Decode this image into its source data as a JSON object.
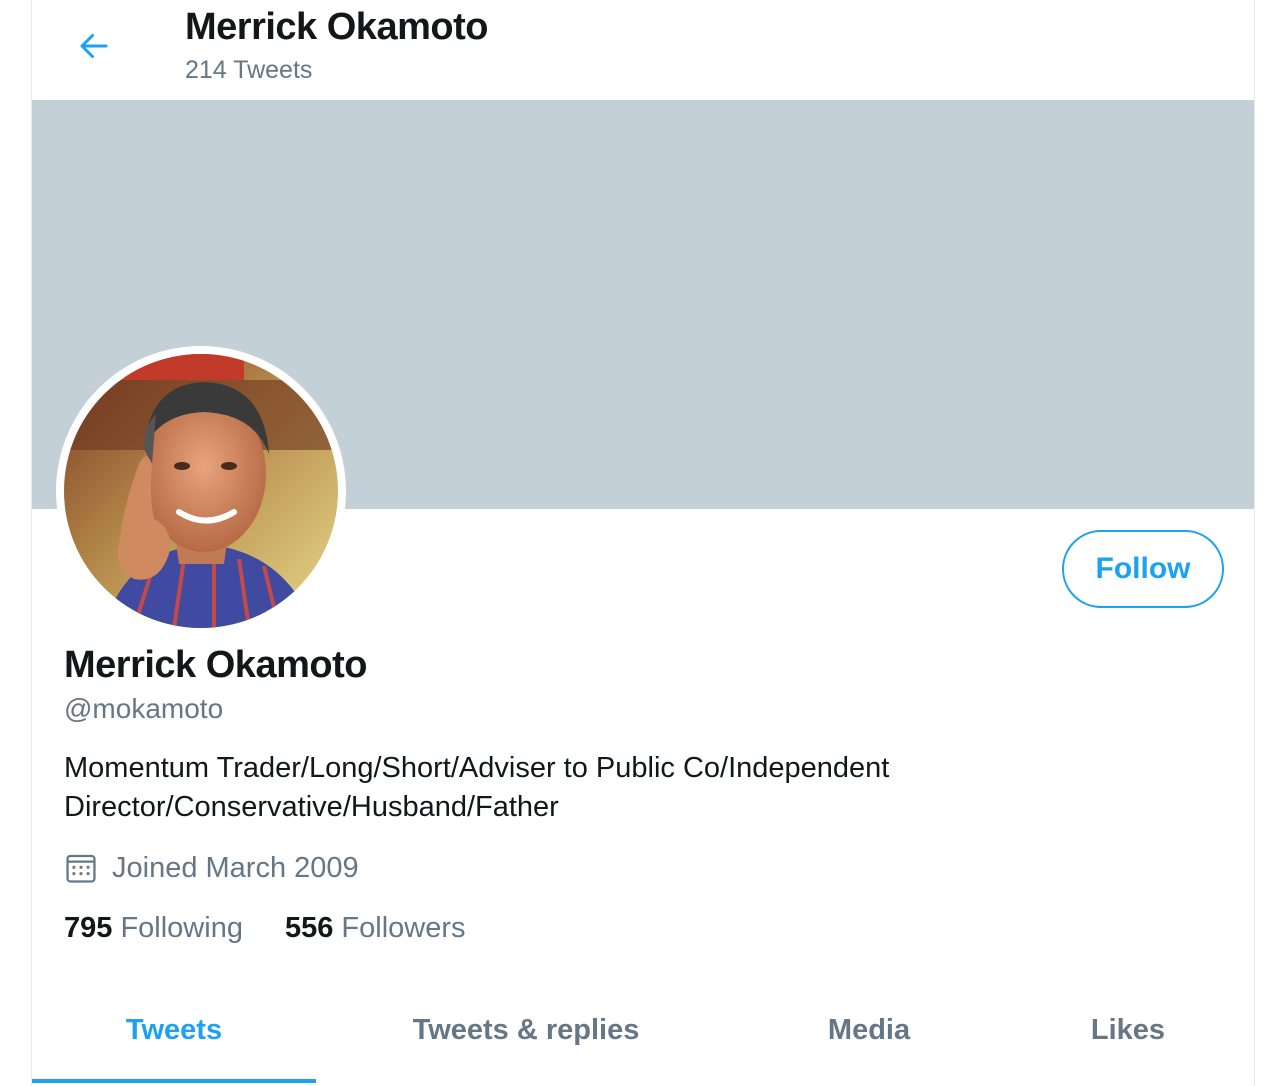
{
  "header": {
    "title": "Merrick Okamoto",
    "subtitle": "214 Tweets"
  },
  "profile": {
    "display_name": "Merrick Okamoto",
    "handle": "@mokamoto",
    "bio_line1": "Momentum Trader/Long/Short/Adviser to Public Co/Independent",
    "bio_line2": "Director/Conservative/Husband/Father",
    "joined": "Joined March 2009",
    "follow_label": "Follow",
    "following_count": "795",
    "following_label": "Following",
    "followers_count": "556",
    "followers_label": "Followers"
  },
  "tabs": [
    {
      "label": "Tweets",
      "active": true
    },
    {
      "label": "Tweets & replies",
      "active": false
    },
    {
      "label": "Media",
      "active": false
    },
    {
      "label": "Likes",
      "active": false
    }
  ],
  "icons": {
    "back": "arrow-left-icon",
    "calendar": "calendar-icon"
  },
  "colors": {
    "accent": "#1da1f2",
    "banner": "#c4d0d8",
    "primary_text": "#14171a",
    "secondary_text": "#657786"
  }
}
